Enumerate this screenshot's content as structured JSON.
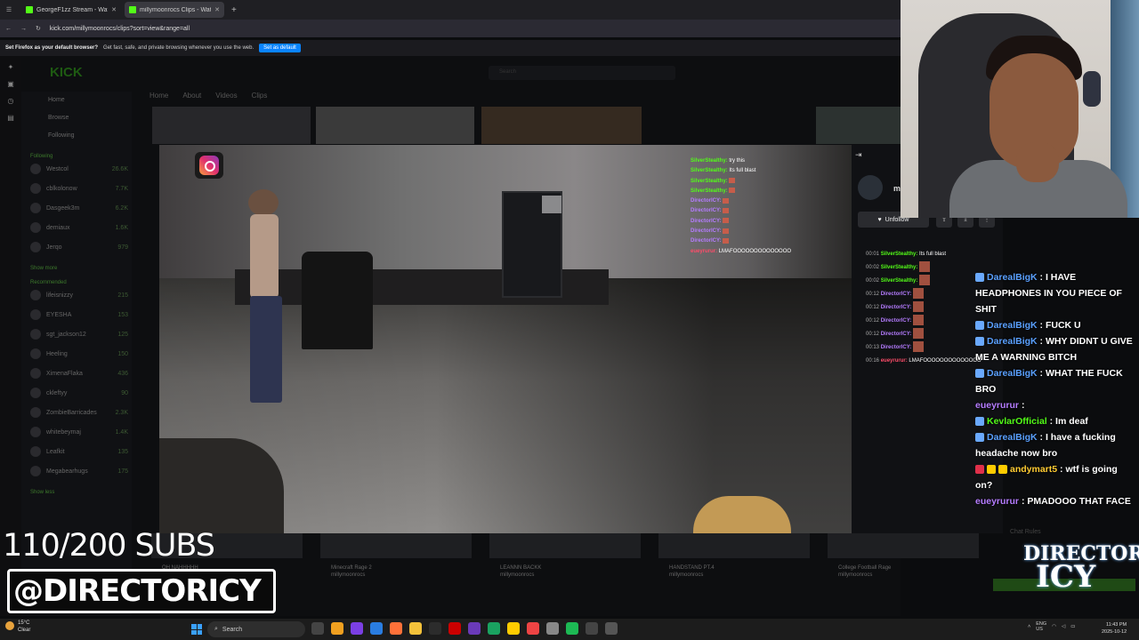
{
  "browser": {
    "tabs": [
      {
        "label": "GeorgeF1zz Stream - Watch",
        "active": false
      },
      {
        "label": "millymoonrocs Clips - Watc",
        "active": true
      }
    ],
    "url": "kick.com/millymoonrocs/clips?sort=view&range=all",
    "notification": {
      "bold": "Set Firefox as your default browser?",
      "text": "Get fast, safe, and private browsing whenever you use the web.",
      "button": "Set as default"
    }
  },
  "kick": {
    "logo": "KICK",
    "search_placeholder": "Search",
    "sidebar": {
      "nav": [
        "Home",
        "Browse",
        "Following"
      ],
      "following_header": "Following",
      "following": [
        {
          "name": "Westcol",
          "viewers": "26.6K"
        },
        {
          "name": "cblkolonow",
          "viewers": "7.7K"
        },
        {
          "name": "Dasgeek3m",
          "viewers": "6.2K"
        },
        {
          "name": "demiaux",
          "viewers": "1.6K"
        },
        {
          "name": "Jerqo",
          "viewers": "979"
        }
      ],
      "show_more_1": "Show more",
      "recommended_header": "Recommended",
      "recommended": [
        {
          "name": "lifeisnizzy",
          "viewers": "215"
        },
        {
          "name": "EYESHA",
          "viewers": "153"
        },
        {
          "name": "sgt_jackson12",
          "viewers": "125"
        },
        {
          "name": "Heeling",
          "viewers": "150"
        },
        {
          "name": "XimenaFlaka",
          "viewers": "436"
        },
        {
          "name": "ckleftyy",
          "viewers": "90"
        },
        {
          "name": "ZombieBarricades",
          "viewers": "2.3K"
        },
        {
          "name": "whitebeymaj",
          "viewers": "1.4K"
        },
        {
          "name": "Leafkit",
          "viewers": "135"
        },
        {
          "name": "Megabearhugs",
          "viewers": "175"
        }
      ],
      "show_more_2": "Show more",
      "show_less": "Show less"
    },
    "tabs": [
      "Home",
      "About",
      "Videos",
      "Clips"
    ],
    "unfollow": "Unfollow",
    "channel_initial": "m",
    "bottom_clips": [
      {
        "title": "OH NAHHHHH",
        "views": ""
      },
      {
        "title": "Minecraft Rage 2",
        "views": "118 views"
      },
      {
        "title": "LEANNN BACKK",
        "views": "115 views"
      },
      {
        "title": "HANDSTAND PT.4",
        "views": "114 views"
      },
      {
        "title": "College Football Rage",
        "views": "113 views"
      }
    ],
    "clip_owner": "millymoonrocs",
    "chat_rules": "Chat Rules",
    "chat_count": "140"
  },
  "video_chat": [
    {
      "user": "SilverStealthy:",
      "text": "try this",
      "color": "#53fc18"
    },
    {
      "user": "SilverStealthy:",
      "text": "Its full blast",
      "color": "#53fc18"
    },
    {
      "user": "SilverStealthy:",
      "text": "",
      "color": "#53fc18",
      "emote": true
    },
    {
      "user": "SilverStealthy:",
      "text": "",
      "color": "#53fc18",
      "emote": true
    },
    {
      "user": "DirectorICY:",
      "text": "",
      "color": "#b57cff",
      "emote": true
    },
    {
      "user": "DirectorICY:",
      "text": "",
      "color": "#b57cff",
      "emote": true
    },
    {
      "user": "DirectorICY:",
      "text": "",
      "color": "#b57cff",
      "emote": true
    },
    {
      "user": "DirectorICY:",
      "text": "",
      "color": "#b57cff",
      "emote": true
    },
    {
      "user": "DirectorICY:",
      "text": "",
      "color": "#b57cff",
      "emote": true
    },
    {
      "user": "eueyrurur:",
      "text": "LMAFOOOOOOOOOOOOOO",
      "color": "#ff4d6a"
    }
  ],
  "kick_timeline": [
    {
      "time": "00:01",
      "user": "SilverStealthy:",
      "text": "Its full blast",
      "color": "#53fc18"
    },
    {
      "time": "00:02",
      "user": "SilverStealthy:",
      "text": "",
      "color": "#53fc18",
      "emote": true
    },
    {
      "time": "00:02",
      "user": "SilverStealthy:",
      "text": "",
      "color": "#53fc18",
      "emote": true
    },
    {
      "time": "00:12",
      "user": "DirectorICY:",
      "text": "",
      "color": "#b57cff",
      "emote": true
    },
    {
      "time": "00:12",
      "user": "DirectorICY:",
      "text": "",
      "color": "#b57cff",
      "emote": true
    },
    {
      "time": "00:12",
      "user": "DirectorICY:",
      "text": "",
      "color": "#b57cff",
      "emote": true
    },
    {
      "time": "00:12",
      "user": "DirectorICY:",
      "text": "",
      "color": "#b57cff",
      "emote": true
    },
    {
      "time": "00:13",
      "user": "DirectorICY:",
      "text": "",
      "color": "#b57cff",
      "emote": true
    },
    {
      "time": "00:16",
      "user": "eueyrurur:",
      "text": "LMAFOOOOOOOOOOOOOO",
      "color": "#ff4d6a"
    }
  ],
  "stream_chat": [
    {
      "user": "DarealBigK",
      "text": "I HAVE HEADPHONES IN YOU PIECE OF SHIT",
      "color": "#5aa0ff",
      "badge": "blue"
    },
    {
      "user": "DarealBigK",
      "text": "FUCK U",
      "color": "#5aa0ff",
      "badge": "blue"
    },
    {
      "user": "DarealBigK",
      "text": "WHY DIDNT U GIVE ME A WARNING BITCH",
      "color": "#5aa0ff",
      "badge": "blue"
    },
    {
      "user": "DarealBigK",
      "text": "WHAT THE FUCK BRO",
      "color": "#5aa0ff",
      "badge": "blue"
    },
    {
      "user": "eueyrurur",
      "text": "",
      "color": "#b57cff",
      "badge": "none"
    },
    {
      "user": "KevlarOfficial",
      "text": "Im deaf",
      "color": "#53fc18",
      "badge": "blue"
    },
    {
      "user": "DarealBigK",
      "text": "I have a fucking headache now bro",
      "color": "#5aa0ff",
      "badge": "blue"
    },
    {
      "user": "andymart5",
      "text": "wtf is going on?",
      "color": "#ffcc33",
      "badge": "multi"
    },
    {
      "user": "eueyrurur",
      "text": "PMADOOO THAT FACE",
      "color": "#b57cff",
      "badge": "none"
    }
  ],
  "overlay": {
    "subs": "110/200 SUBS",
    "handle": "@DIRECTORICY",
    "logo_top": "DIRECTOR",
    "logo_bottom": "ICY"
  },
  "taskbar": {
    "weather_temp": "15°C",
    "weather_desc": "Clear",
    "search": "Search",
    "lang": "ENG",
    "region": "US",
    "time": "11:43 PM",
    "date": "2025-10-12"
  },
  "colors": {
    "kick_green": "#53fc18",
    "director_purple": "#b57cff"
  }
}
